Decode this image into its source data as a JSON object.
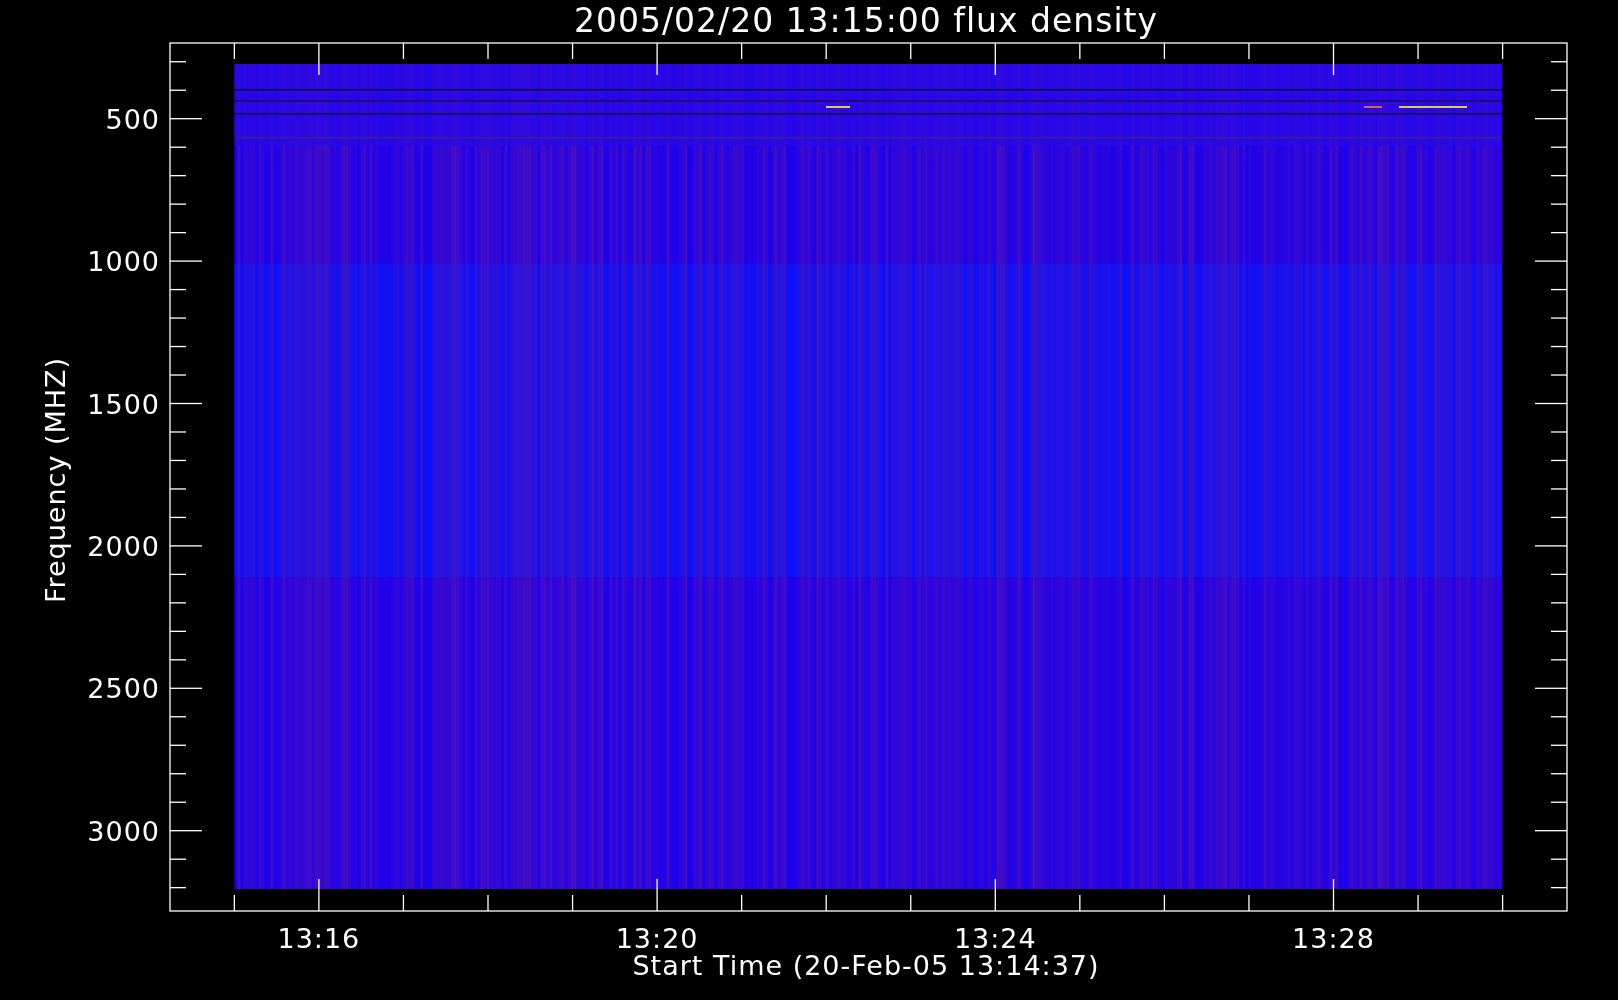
{
  "plot": {
    "title": "2005/02/20 13:15:00 flux density",
    "xlabel": "Start Time (20-Feb-05 13:14:37)",
    "ylabel": "Frequency (MHZ)",
    "x_tick_labels": [
      "13:16",
      "13:20",
      "13:24",
      "13:28"
    ],
    "y_tick_labels": [
      "500",
      "1000",
      "1500",
      "2000",
      "2500",
      "3000"
    ]
  }
}
